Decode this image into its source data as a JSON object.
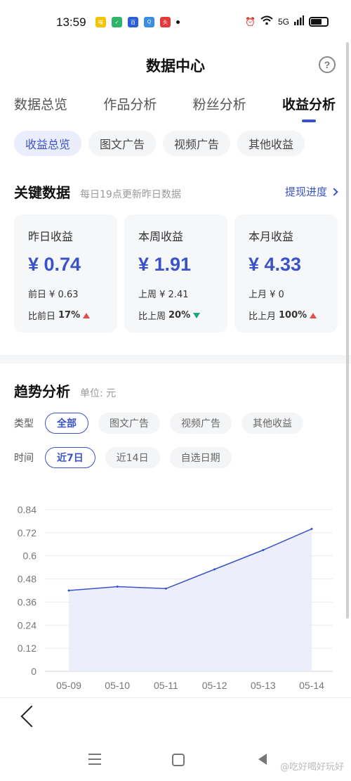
{
  "status": {
    "time": "13:59",
    "app_icons": [
      {
        "name": "app-icon-1",
        "label": "喵",
        "color": "#f5c400"
      },
      {
        "name": "app-icon-2",
        "label": "✓",
        "color": "#2fb46a"
      },
      {
        "name": "app-icon-3",
        "label": "百",
        "color": "#2b5fd9"
      },
      {
        "name": "app-icon-4",
        "label": "Q",
        "color": "#3a8de0"
      },
      {
        "name": "app-icon-5",
        "label": "头",
        "color": "#e03a3a"
      }
    ],
    "right_text": "5G"
  },
  "header": {
    "title": "数据中心",
    "help": "?"
  },
  "main_tabs": [
    {
      "label": "数据总览"
    },
    {
      "label": "作品分析"
    },
    {
      "label": "粉丝分析"
    },
    {
      "label": "收益分析"
    }
  ],
  "sub_tabs": [
    {
      "label": "收益总览"
    },
    {
      "label": "图文广告"
    },
    {
      "label": "视频广告"
    },
    {
      "label": "其他收益"
    }
  ],
  "key_data": {
    "title": "关键数据",
    "subtitle": "每日19点更新昨日数据",
    "link": "提现进度",
    "cards": [
      {
        "label": "昨日收益",
        "value": "¥ 0.74",
        "prev": "前日 ¥ 0.63",
        "cmp_label": "比前日",
        "cmp_value": "17%",
        "trend": "up"
      },
      {
        "label": "本周收益",
        "value": "¥ 1.91",
        "prev": "上周 ¥ 2.41",
        "cmp_label": "比上周",
        "cmp_value": "20%",
        "trend": "down"
      },
      {
        "label": "本月收益",
        "value": "¥ 4.33",
        "prev": "上月 ¥ 0",
        "cmp_label": "比上月",
        "cmp_value": "100%",
        "trend": "up"
      }
    ]
  },
  "trend": {
    "title": "趋势分析",
    "unit": "单位: 元",
    "type_label": "类型",
    "type_options": [
      "全部",
      "图文广告",
      "视频广告",
      "其他收益"
    ],
    "time_label": "时间",
    "time_options": [
      "近7日",
      "近14日",
      "自选日期"
    ]
  },
  "chart_data": {
    "type": "area",
    "x": [
      "05-09",
      "05-10",
      "05-11",
      "05-12",
      "05-13",
      "05-14"
    ],
    "values": [
      0.42,
      0.44,
      0.43,
      0.53,
      0.63,
      0.74
    ],
    "ylim": [
      0,
      0.84
    ],
    "yticks": [
      "0",
      "0.12",
      "0.24",
      "0.36",
      "0.48",
      "0.6",
      "0.72",
      "0.84"
    ],
    "line_color": "#3a53c9",
    "fill_color": "#e9ecfa",
    "grid": true
  },
  "watermark": "@吃好喝好玩好"
}
